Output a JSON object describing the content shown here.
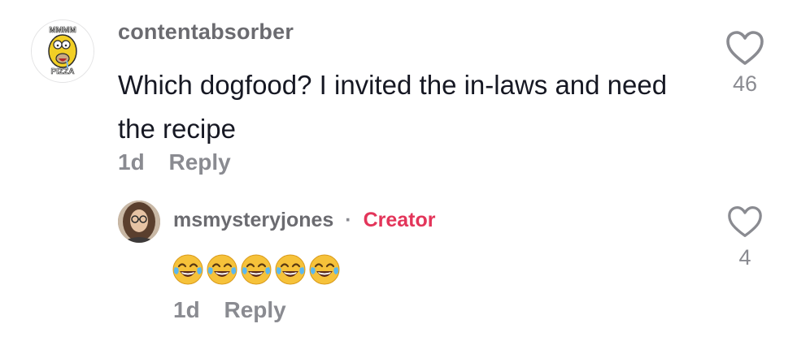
{
  "comment": {
    "avatar": {
      "icon": "homer-pizza-avatar",
      "text_top": "MMMM",
      "text_bottom": "PIZZA"
    },
    "username": "contentabsorber",
    "text": "Which dogfood? I invited the in-laws and need the recipe",
    "time": "1d",
    "reply_label": "Reply",
    "like_icon": "heart-outline-icon",
    "like_count": "46"
  },
  "reply": {
    "avatar": {
      "icon": "user-photo-avatar"
    },
    "username": "msmysteryjones",
    "separator": "·",
    "badge": "Creator",
    "emojis": [
      "😂",
      "😂",
      "😂",
      "😂",
      "😂"
    ],
    "time": "1d",
    "reply_label": "Reply",
    "like_icon": "heart-outline-icon",
    "like_count": "4"
  },
  "colors": {
    "primary_text": "#161823",
    "secondary_text": "#8a8b91",
    "username": "#6b6b70",
    "creator_badge": "#e3355a",
    "emoji_face": "#f6c23a"
  }
}
